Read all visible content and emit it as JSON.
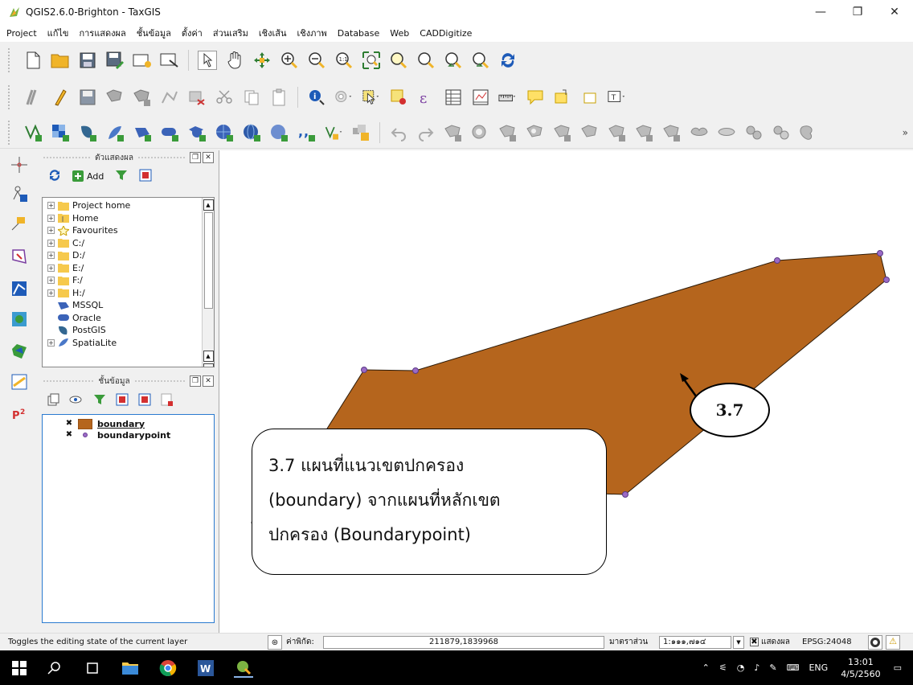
{
  "window": {
    "title": "QGIS2.6.0-Brighton - TaxGIS",
    "minimize": "—",
    "maximize": "❐",
    "close": "✕"
  },
  "menu": [
    "Project",
    "แก้ไข",
    "การแสดงผล",
    "ชั้นข้อมูล",
    "ตั้งค่า",
    "ส่วนเสริม",
    "เชิงเส้น",
    "เชิงภาพ",
    "Database",
    "Web",
    "CADDigitize"
  ],
  "toolbars": {
    "overflow": "»"
  },
  "browser_panel": {
    "title": "ตัวแสดงผล",
    "add_label": "Add",
    "items": [
      {
        "label": "Project home",
        "icon": "folder-icon",
        "expandable": true
      },
      {
        "label": "Home",
        "icon": "home-folder-icon",
        "expandable": true
      },
      {
        "label": "Favourites",
        "icon": "star-icon",
        "expandable": true
      },
      {
        "label": "C:/",
        "icon": "folder-icon",
        "expandable": true
      },
      {
        "label": "D:/",
        "icon": "folder-icon",
        "expandable": true
      },
      {
        "label": "E:/",
        "icon": "folder-icon",
        "expandable": true
      },
      {
        "label": "F:/",
        "icon": "folder-icon",
        "expandable": true
      },
      {
        "label": "H:/",
        "icon": "folder-icon",
        "expandable": true
      },
      {
        "label": "MSSQL",
        "icon": "mssql-icon",
        "expandable": false
      },
      {
        "label": "Oracle",
        "icon": "oracle-icon",
        "expandable": false
      },
      {
        "label": "PostGIS",
        "icon": "postgis-icon",
        "expandable": false
      },
      {
        "label": "SpatiaLite",
        "icon": "spatialite-icon",
        "expandable": true
      }
    ]
  },
  "layers_panel": {
    "title": "ชั้นข้อมูล",
    "layers": [
      {
        "name": "boundary",
        "checked": true,
        "symbol": "polygon",
        "color": "#b5651d"
      },
      {
        "name": "boundarypoint",
        "checked": true,
        "symbol": "point",
        "color": "#9b6bc6"
      }
    ]
  },
  "map": {
    "polygon_fill": "#b5651d",
    "vertex_color": "#9b6bc6"
  },
  "callouts": {
    "label": "3.7",
    "description_line1": "3.7 แผนที่แนวเขตปกครอง",
    "description_line2": "(boundary) จากแผนที่หลักเขต",
    "description_line3": "ปกครอง (Boundarypoint)"
  },
  "statusbar": {
    "message": "Toggles the editing state of the current layer",
    "coord_label": "ค่าพิกัด:",
    "coord_value": "211879,1839968",
    "scale_label": "มาตราส่วน",
    "scale_value": "1:๑๑๑,๗๑๔",
    "render_label": "แสดงผล",
    "epsg": "EPSG:24048"
  },
  "taskbar": {
    "language": "ENG",
    "time": "13:01",
    "date": "4/5/2560"
  }
}
